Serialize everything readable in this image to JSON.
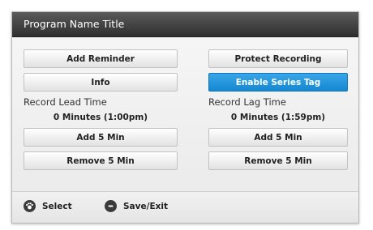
{
  "dialog": {
    "title": "Program Name Title"
  },
  "buttons": {
    "add_reminder": "Add Reminder",
    "protect_recording": "Protect Recording",
    "info": "Info",
    "enable_series_tag": "Enable Series Tag"
  },
  "lead": {
    "label": "Record Lead Time",
    "value": "0 Minutes (1:00pm)",
    "add": "Add 5 Min",
    "remove": "Remove 5 Min"
  },
  "lag": {
    "label": "Record Lag Time",
    "value": "0 Minutes (1:59pm)",
    "add": "Add 5 Min",
    "remove": "Remove 5 Min"
  },
  "footer": {
    "select_label": "Select",
    "save_exit_label": "Save/Exit",
    "select_icon": "paw-dpad-icon",
    "save_exit_icon": "remote-button-icon"
  },
  "colors": {
    "accent": "#1a8fd6",
    "titlebar": "#3a3a3a"
  }
}
